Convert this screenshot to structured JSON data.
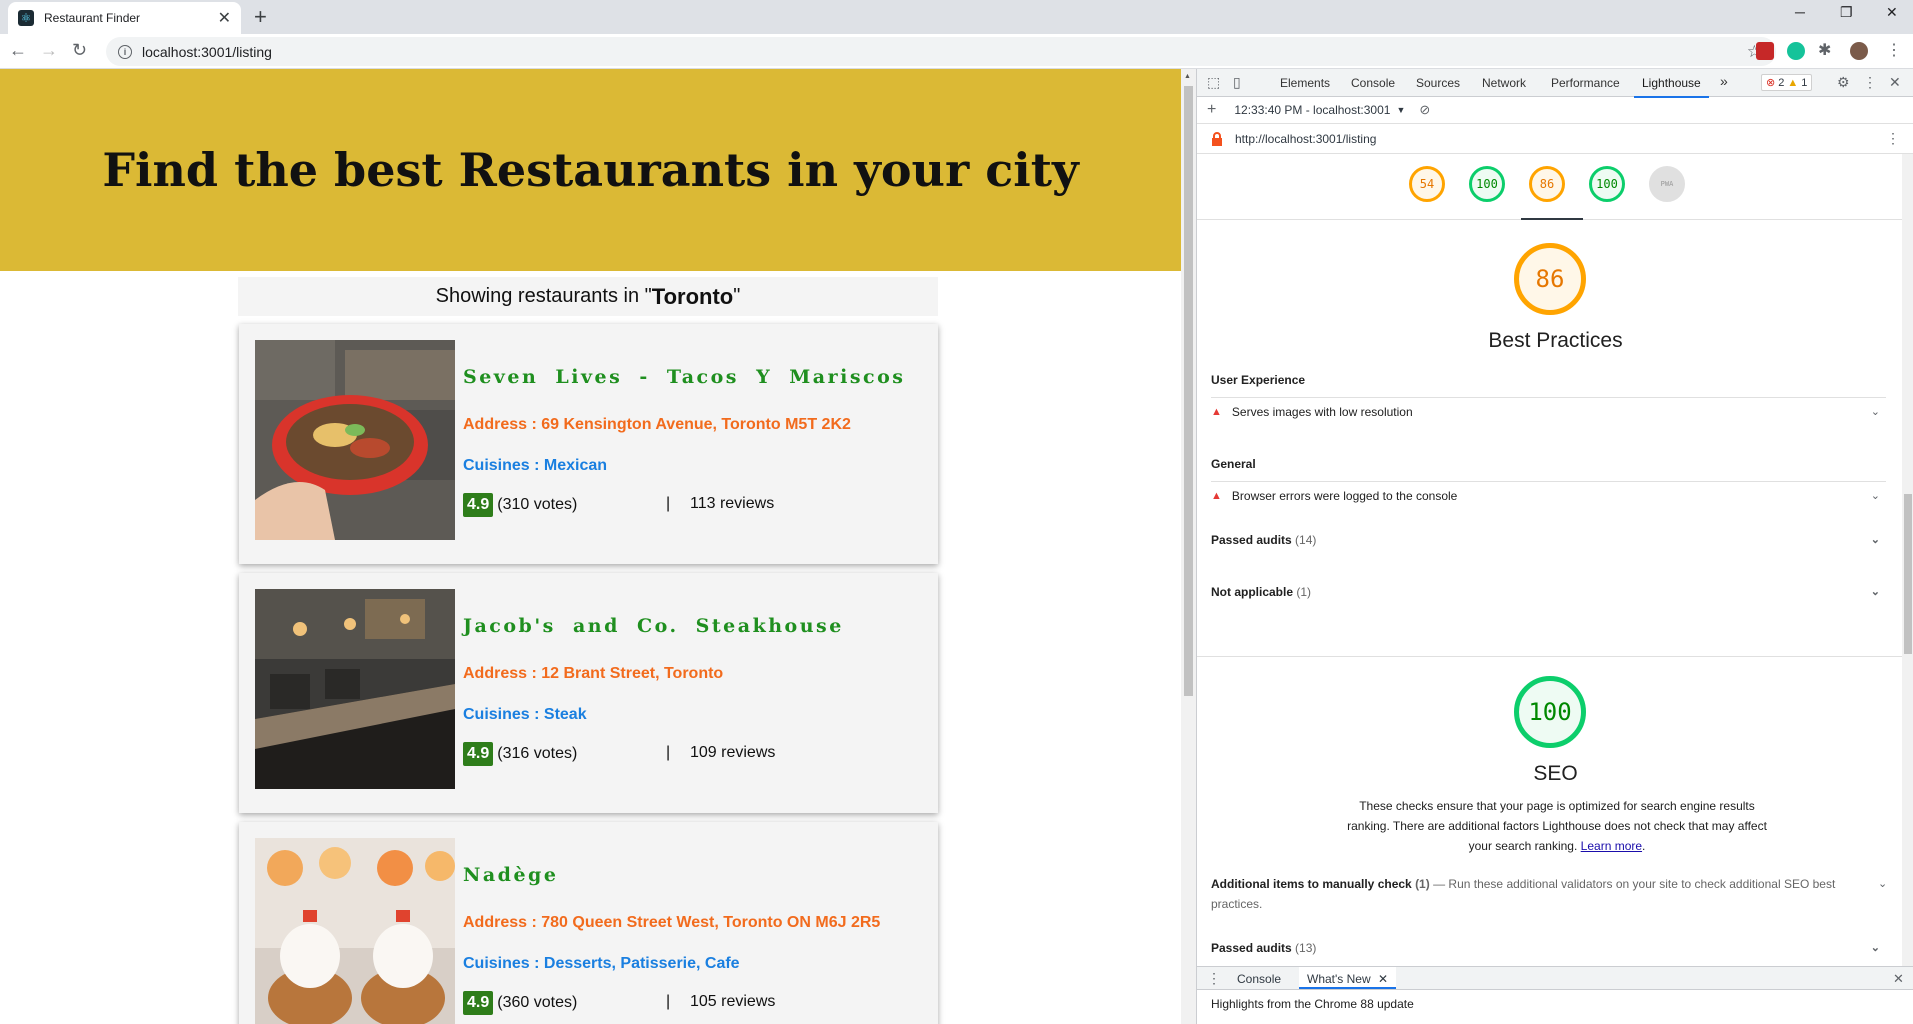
{
  "browser": {
    "tab_title": "Restaurant Finder",
    "tab_close": "✕",
    "new_tab": "+",
    "url": "localhost:3001/listing",
    "win_minimize": "─",
    "win_restore": "❐",
    "win_close": "✕"
  },
  "page": {
    "hero_title": "Find the best Restaurants in your city",
    "showing_prefix": "Showing restaurants in \"",
    "city": "Toronto",
    "showing_suffix": "\"",
    "restaurants": [
      {
        "name": "Seven Lives - Tacos Y Mariscos",
        "address": "Address : 69 Kensington Avenue, Toronto M5T 2K2",
        "cuisines": "Cuisines : Mexican",
        "rating": "4.9",
        "votes": "(310 votes)",
        "reviews": "113 reviews"
      },
      {
        "name": "Jacob's and Co. Steakhouse",
        "address": "Address : 12 Brant Street, Toronto",
        "cuisines": "Cuisines : Steak",
        "rating": "4.9",
        "votes": "(316 votes)",
        "reviews": "109 reviews"
      },
      {
        "name": "Nadège",
        "address": "Address : 780 Queen Street West, Toronto ON M6J 2R5",
        "cuisines": "Cuisines : Desserts, Patisserie, Cafe",
        "rating": "4.9",
        "votes": "(360 votes)",
        "reviews": "105 reviews"
      }
    ],
    "pipe": "|"
  },
  "devtools": {
    "tabs": [
      "Elements",
      "Console",
      "Sources",
      "Network",
      "Performance",
      "Lighthouse"
    ],
    "more_tabs": "»",
    "errors": "2",
    "warnings": "1",
    "report_time": "12:33:40 PM - localhost:3001",
    "report_url": "http://localhost:3001/listing",
    "gauges": [
      "54",
      "100",
      "86",
      "100",
      "PWA"
    ],
    "best_practices": {
      "score": "86",
      "title": "Best Practices",
      "group_user_experience": "User Experience",
      "audit_low_res": "Serves images with low resolution",
      "group_general": "General",
      "audit_console_errors": "Browser errors were logged to the console",
      "passed_label": "Passed audits",
      "passed_count": "(14)",
      "na_label": "Not applicable",
      "na_count": "(1)"
    },
    "seo": {
      "score": "100",
      "title": "SEO",
      "description": "These checks ensure that your page is optimized for search engine results ranking. There are additional factors Lighthouse does not check that may affect your search ranking.",
      "learn_more": "Learn more",
      "manual_label": "Additional items to manually check",
      "manual_count": "(1)",
      "manual_text": " — Run these additional validators on your site to check additional SEO best practices.",
      "passed_label": "Passed audits",
      "passed_count": "(13)"
    },
    "drawer": {
      "tab_console": "Console",
      "tab_whats_new": "What's New",
      "body": "Highlights from the Chrome 88 update"
    }
  },
  "colors": {
    "hero_bg": "#dbb935",
    "name_green": "#1f8f1f",
    "address_orange": "#f26b1d",
    "cuisine_blue": "#1a7fe0",
    "rating_badge": "#2e7d1a",
    "gauge_orange": "#ffa400",
    "gauge_green": "#0cce6b"
  }
}
